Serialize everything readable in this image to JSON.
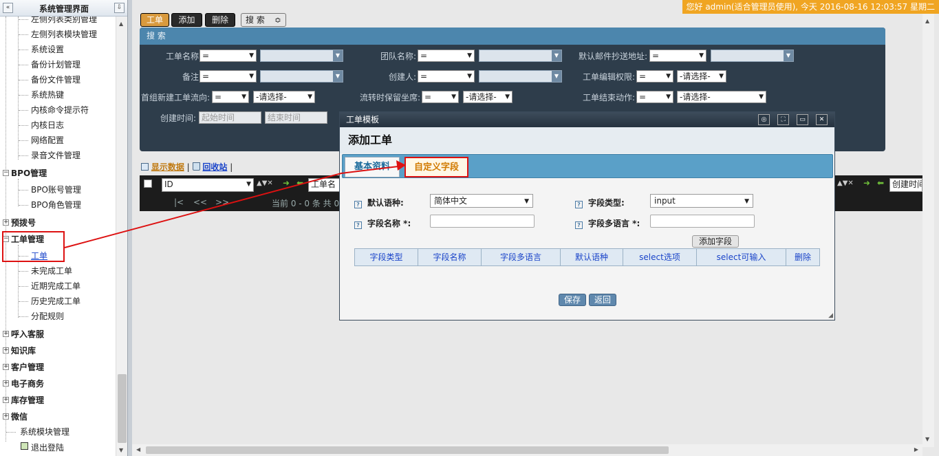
{
  "sidebar": {
    "title": "系统管理界面",
    "collapse_glyph": "«",
    "pin_glyph": "⇩",
    "items_top": [
      {
        "label": "左侧列表类别管理"
      },
      {
        "label": "左侧列表模块管理"
      },
      {
        "label": "系统设置"
      },
      {
        "label": "备份计划管理"
      },
      {
        "label": "备份文件管理"
      },
      {
        "label": "系统热键"
      },
      {
        "label": "内核命令提示符"
      },
      {
        "label": "内核日志"
      },
      {
        "label": "网络配置"
      },
      {
        "label": "录音文件管理"
      }
    ],
    "group_bpo": {
      "label": "BPO管理",
      "sign": "−"
    },
    "items_bpo": [
      {
        "label": "BPO账号管理"
      },
      {
        "label": "BPO角色管理"
      }
    ],
    "group_predial": {
      "label": "预拨号",
      "sign": "+"
    },
    "group_ticket": {
      "label": "工单管理",
      "sign": "−"
    },
    "items_ticket": [
      {
        "label": "工单"
      },
      {
        "label": "未完成工单"
      },
      {
        "label": "近期完成工单"
      },
      {
        "label": "历史完成工单"
      },
      {
        "label": "分配规则"
      }
    ],
    "groups_bottom": [
      {
        "label": "呼入客服",
        "sign": "+"
      },
      {
        "label": "知识库",
        "sign": "+"
      },
      {
        "label": "客户管理",
        "sign": "+"
      },
      {
        "label": "电子商务",
        "sign": "+"
      },
      {
        "label": "库存管理",
        "sign": "+"
      },
      {
        "label": "微信",
        "sign": "+"
      }
    ],
    "module_mgmt": "系统模块管理",
    "logout": "退出登陆"
  },
  "greeting": "您好 admin(适合管理员使用), 今天 2016-08-16 12:03:57 星期二",
  "toolbar": {
    "ticket": "工单",
    "add": "添加",
    "delete": "删除",
    "search": "搜 索",
    "search_glyph": "≎"
  },
  "search": {
    "title": "搜 索",
    "op_eq": "=",
    "please_select": "-请选择-",
    "labels": {
      "ticket_name": "工单名称:",
      "team_name": "团队名称:",
      "default_cc": "默认邮件抄送地址:",
      "remark": "备注:",
      "creator": "创建人:",
      "edit_perm": "工单编辑权限:",
      "first_flow": "首组新建工单流向:",
      "keep_seat": "流转时保留坐席:",
      "end_action": "工单结束动作:",
      "created_time": "创建时间:"
    },
    "start_time_ph": "起始时间",
    "end_time_ph": "结束时间"
  },
  "list": {
    "show_data": "显示数据",
    "recycle": "回收站",
    "sep": "|",
    "col_id": "ID",
    "col_ticket": "工单名",
    "col_created": "创建时间",
    "pager_first": "|<",
    "pager_prev": "<<",
    "pager_next": ">>",
    "pager_info": "当前 0 - 0 条 共 0"
  },
  "modal": {
    "title": "工单模板",
    "subtitle": "添加工单",
    "tab_basic": "基本资料",
    "tab_custom": "自定义字段",
    "help_glyph": "?",
    "default_lang_label": "默认语种:",
    "default_lang_value": "简体中文",
    "field_type_label": "字段类型:",
    "field_type_value": "input",
    "field_name_label": "字段名称 *:",
    "field_ml_label": "字段多语言 *:",
    "add_field": "添加字段",
    "table_headers": [
      "字段类型",
      "字段名称",
      "字段多语言",
      "默认语种",
      "select选项",
      "select可输入",
      "删除"
    ],
    "save": "保存",
    "back": "返回"
  },
  "colors": {
    "annotation_red": "#dd1111",
    "greeting_bg": "#f0a522",
    "tab_bar_blue": "#5aa0c8"
  }
}
